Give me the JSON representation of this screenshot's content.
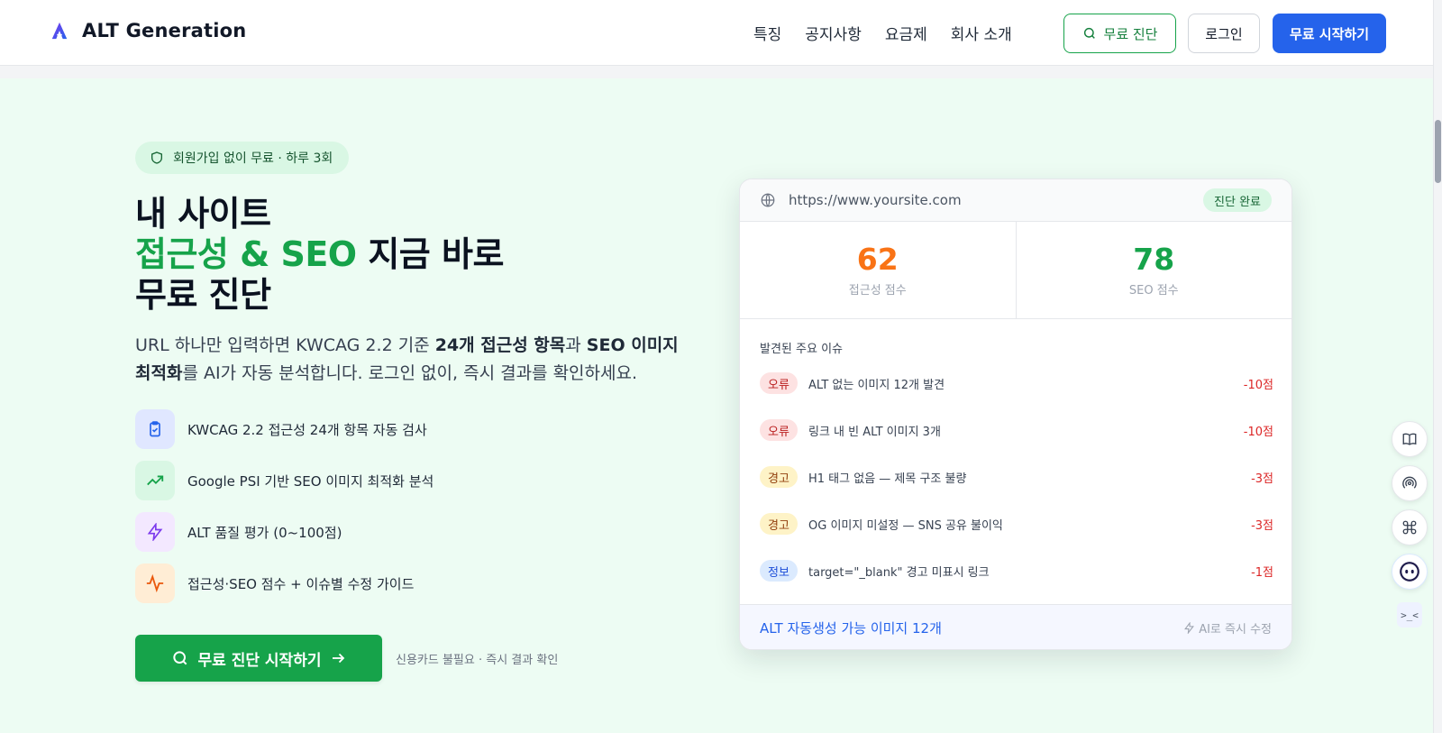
{
  "header": {
    "brand": "ALT Generation",
    "nav": [
      "특징",
      "공지사항",
      "요금제",
      "회사 소개"
    ],
    "diagnose_button": "무료 진단",
    "login_button": "로그인",
    "start_button": "무료 시작하기"
  },
  "hero": {
    "badge": "회원가입 없이 무료 · 하루 3회",
    "headline_line1": "내 사이트",
    "headline_line2_accent": "접근성 & SEO",
    "headline_line2_rest": " 지금 바로",
    "headline_line3": "무료 진단",
    "desc_part1": "URL 하나만 입력하면 KWCAG 2.2 기준 ",
    "desc_bold1": "24개 접근성 항목",
    "desc_part2": "과 ",
    "desc_bold2": "SEO 이미지 최적화",
    "desc_part3": "를 AI가 자동 분석합니다. 로그인 없이, 즉시 결과를 확인하세요.",
    "features": [
      {
        "label": "KWCAG 2.2 접근성 24개 항목 자동 검사",
        "icon": "clipboard-check-icon"
      },
      {
        "label": "Google PSI 기반 SEO 이미지 최적화 분석",
        "icon": "trending-up-icon"
      },
      {
        "label": "ALT 품질 평가 (0~100점)",
        "icon": "lightning-icon"
      },
      {
        "label": "접근성·SEO 점수 + 이슈별 수정 가이드",
        "icon": "activity-icon"
      }
    ],
    "cta": "무료 진단 시작하기",
    "cta_note": "신용카드 불필요 · 즉시 결과 확인"
  },
  "card": {
    "url": "https://www.yoursite.com",
    "status": "진단 완료",
    "scores": [
      {
        "value": "62",
        "label": "접근성 점수",
        "color": "#f97316"
      },
      {
        "value": "78",
        "label": "SEO 점수",
        "color": "#16a34a"
      }
    ],
    "issues_title": "발견된 주요 이슈",
    "issues": [
      {
        "tag": "오류",
        "type": "err",
        "text": "ALT 없는 이미지 12개 발견",
        "points": "-10점"
      },
      {
        "tag": "오류",
        "type": "err",
        "text": "링크 내 빈 ALT 이미지 3개",
        "points": "-10점"
      },
      {
        "tag": "경고",
        "type": "warn",
        "text": "H1 태그 없음 — 제목 구조 불량",
        "points": "-3점"
      },
      {
        "tag": "경고",
        "type": "warn",
        "text": "OG 이미지 미설정 — SNS 공유 불이익",
        "points": "-3점"
      },
      {
        "tag": "정보",
        "type": "info",
        "text": "target=\"_blank\" 경고 미표시 링크",
        "points": "-1점"
      }
    ],
    "footer_left": "ALT 자동생성 가능 이미지 12개",
    "footer_right": "AI로 즉시 수정"
  },
  "side_tools": {
    "terminal_label": ">_<"
  },
  "colors": {
    "brand_blue": "#2563eb",
    "brand_green": "#16a34a",
    "hero_bg": "#edfcf3"
  }
}
